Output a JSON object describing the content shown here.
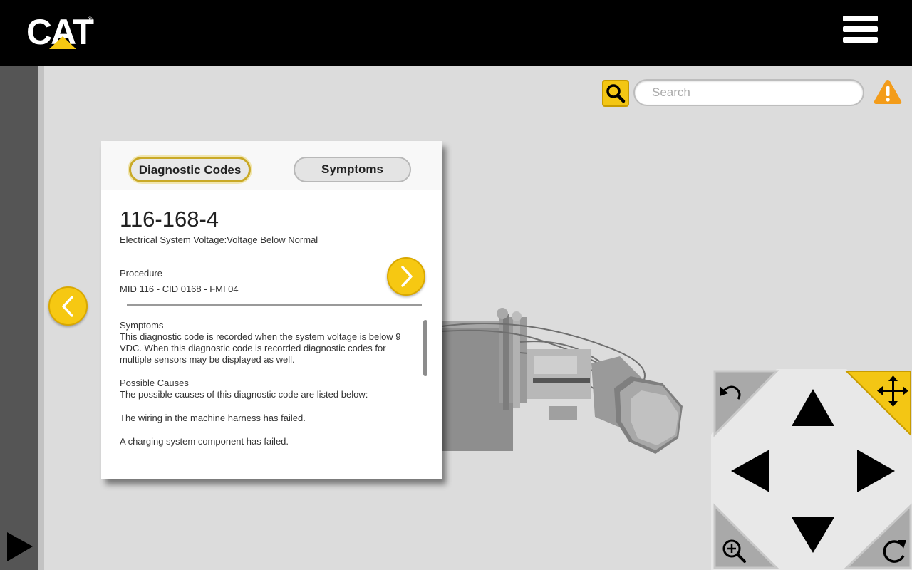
{
  "header": {
    "logo_text": "CAT",
    "logo_mark": "®",
    "menu_icon": "hamburger-menu-icon"
  },
  "search": {
    "placeholder": "Search",
    "search_icon": "magnifier-icon",
    "warning_icon": "warning-triangle-icon"
  },
  "panel": {
    "tabs": [
      {
        "label": "Diagnostic Codes",
        "active": true
      },
      {
        "label": "Symptoms",
        "active": false
      }
    ],
    "code": "116-168-4",
    "code_description": "Electrical System Voltage:Voltage Below Normal",
    "procedure_label": "Procedure",
    "procedure_value": "MID 116 - CID 0168 - FMI 04",
    "symptoms_title": "Symptoms",
    "symptoms_text": "This diagnostic code is recorded when the system voltage is below 9 VDC. When this diagnostic code is recorded diagnostic codes for multiple sensors may be displayed as well.",
    "causes_title": "Possible Causes",
    "causes_intro": "The possible causes of this diagnostic code are listed below:",
    "causes": [
      "The wiring in the machine harness has failed.",
      "A charging system component has failed."
    ]
  },
  "colors": {
    "accent": "#f6c812",
    "header_bg": "#000000",
    "viewport_bg": "#dcdcdc"
  },
  "navpad": {
    "icons": [
      "undo-icon",
      "move-icon",
      "arrow-up-icon",
      "arrow-left-icon",
      "arrow-right-icon",
      "arrow-down-icon",
      "zoom-in-icon",
      "rotate-icon"
    ]
  }
}
